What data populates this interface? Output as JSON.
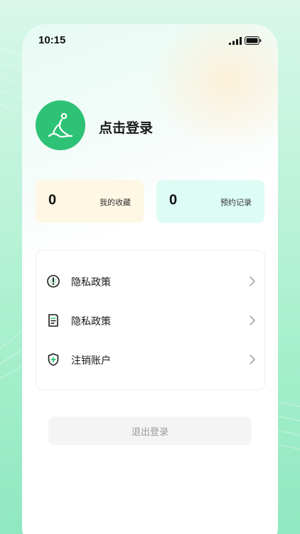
{
  "status_bar": {
    "time": "10:15"
  },
  "profile": {
    "login_prompt": "点击登录"
  },
  "stats": [
    {
      "value": "0",
      "label": "我的收藏"
    },
    {
      "value": "0",
      "label": "预约记录"
    }
  ],
  "menu": {
    "items": [
      {
        "label": "隐私政策",
        "icon": "info-circle-icon"
      },
      {
        "label": "隐私政策",
        "icon": "document-icon"
      },
      {
        "label": "注销账户",
        "icon": "shield-plus-icon"
      }
    ]
  },
  "logout": {
    "label": "退出登录"
  },
  "colors": {
    "brand_green": "#2ec277",
    "favorites_card_bg": "#fdf7e4",
    "booking_card_bg": "#dcfcf5",
    "logout_bg": "#f4f4f4",
    "logout_text": "#9a9a9a"
  }
}
